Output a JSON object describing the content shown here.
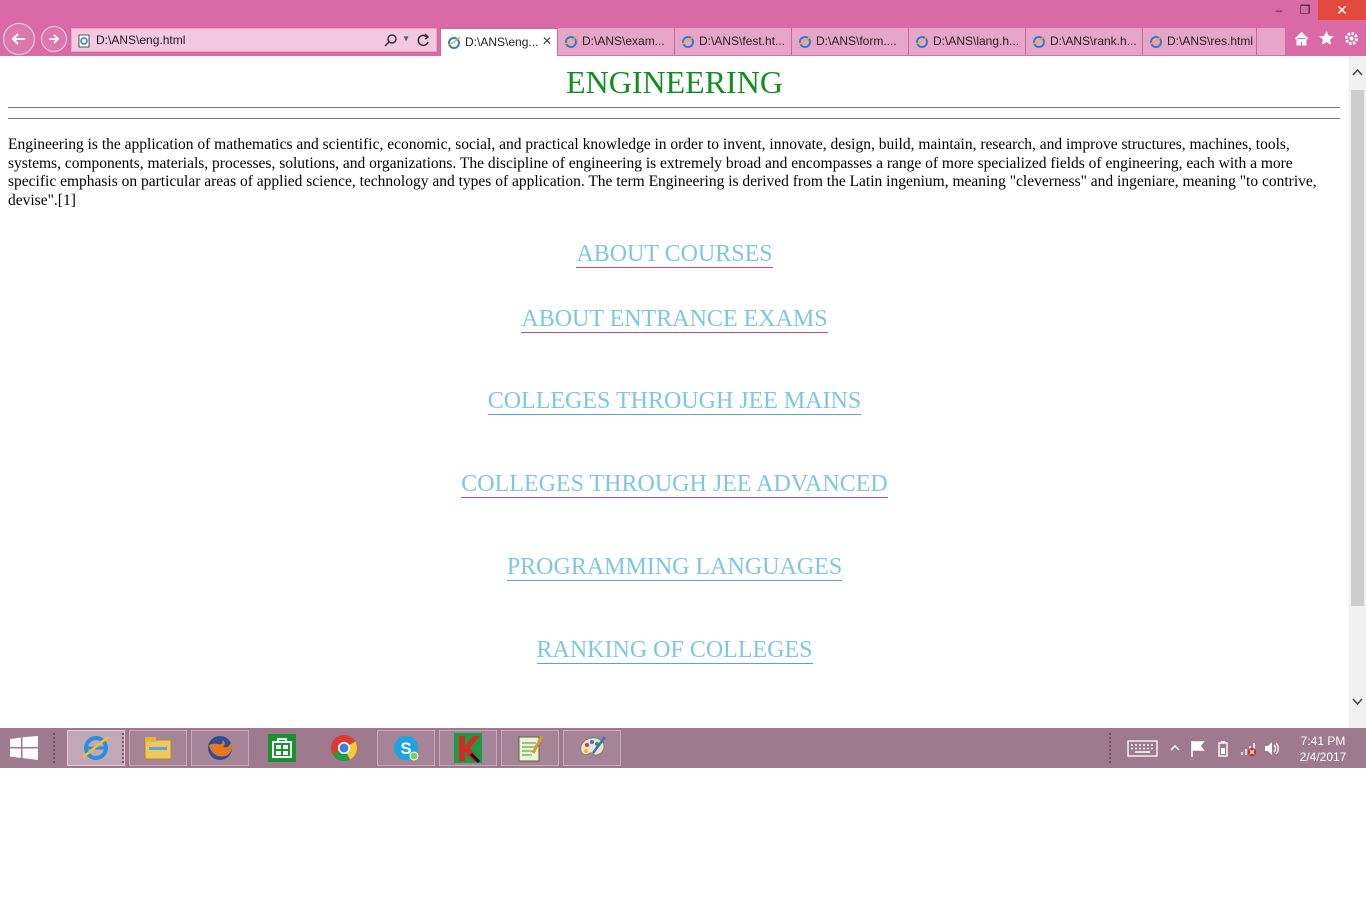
{
  "browser": {
    "address": "D:\\ANS\\eng.html",
    "tabs": [
      {
        "label": "D:\\ANS\\eng...",
        "active": true
      },
      {
        "label": "D:\\ANS\\exam...",
        "active": false
      },
      {
        "label": "D:\\ANS\\fest.ht...",
        "active": false
      },
      {
        "label": "D:\\ANS\\form....",
        "active": false
      },
      {
        "label": "D:\\ANS\\lang.h...",
        "active": false
      },
      {
        "label": "D:\\ANS\\rank.h...",
        "active": false
      },
      {
        "label": "D:\\ANS\\res.html",
        "active": false
      }
    ],
    "icons": [
      "back-icon",
      "forward-icon",
      "search-icon",
      "refresh-icon",
      "home-icon",
      "favorites-star-icon",
      "settings-gear-icon"
    ],
    "chrome_color": "#d96aa6"
  },
  "page": {
    "title": "ENGINEERING",
    "title_color": "#0f8f1e",
    "intro": "Engineering is the application of mathematics and scientific, economic, social, and practical knowledge in order to invent, innovate, design, build, maintain, research, and improve structures, machines, tools, systems, components, materials, processes, solutions, and organizations. The discipline of engineering is extremely broad and encompasses a range of more specialized fields of engineering, each with a more specific emphasis on particular areas of applied science, technology and types of application. The term Engineering is derived from the Latin ingenium, meaning \"cleverness\" and ingeniare, meaning \"to contrive, devise\".[1]",
    "links": [
      "ABOUT COURSES",
      "ABOUT ENTRANCE EXAMS",
      "COLLEGES THROUGH JEE MAINS",
      "COLLEGES THROUGH JEE ADVANCED",
      "PROGRAMMING LANGUAGES",
      "RANKING OF COLLEGES"
    ],
    "link_color": "#7fc6e3"
  },
  "taskbar": {
    "apps": [
      "internet-explorer-icon",
      "file-explorer-icon",
      "firefox-icon",
      "store-icon",
      "chrome-icon",
      "skype-icon",
      "kaspersky-icon",
      "notepad-icon",
      "paint-icon"
    ],
    "time": "7:41 PM",
    "date": "2/4/2017"
  }
}
